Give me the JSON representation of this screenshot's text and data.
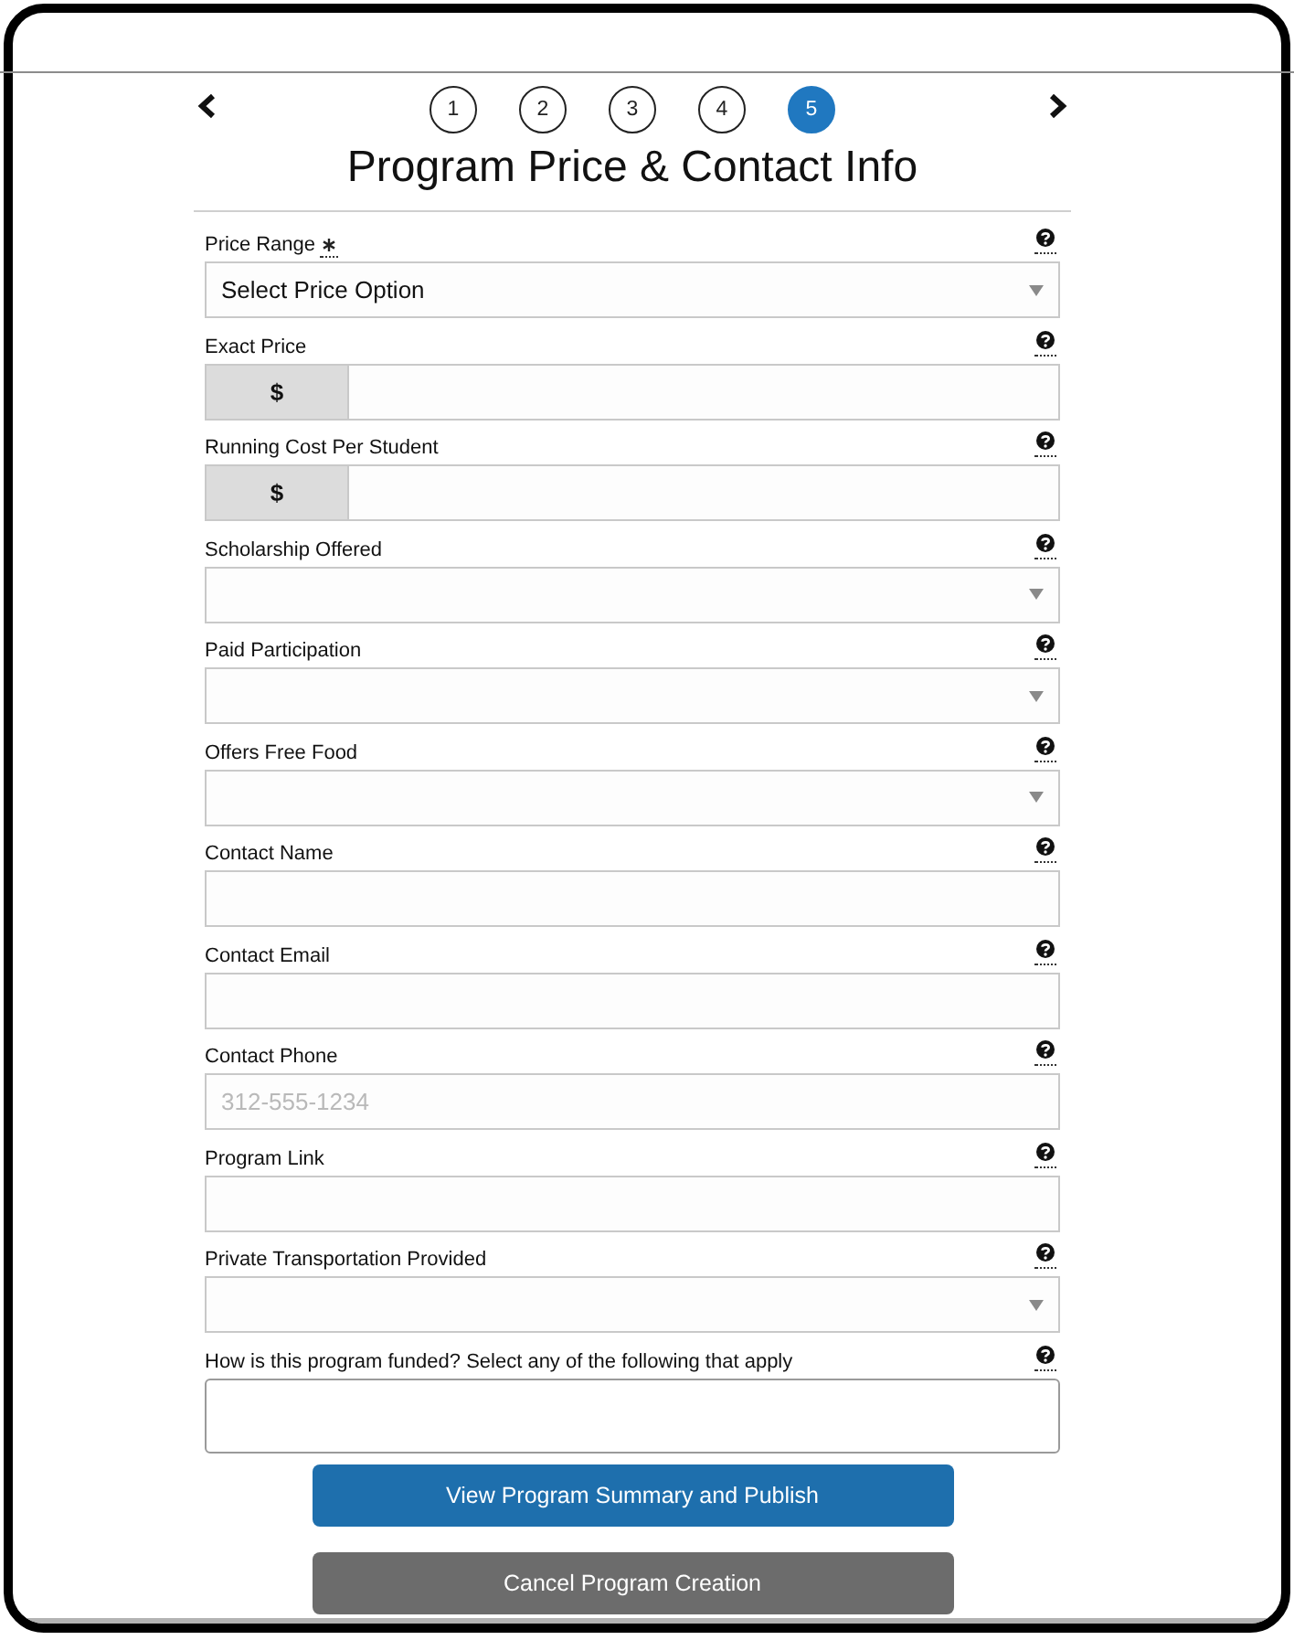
{
  "steps": [
    {
      "label": "1",
      "selected": false
    },
    {
      "label": "2",
      "selected": false
    },
    {
      "label": "3",
      "selected": false
    },
    {
      "label": "4",
      "selected": false
    },
    {
      "label": "5",
      "selected": true
    }
  ],
  "title": "Program Price & Contact Info",
  "fields": [
    {
      "kind": "select",
      "label": "Price Range",
      "required": true,
      "value": "Select Price Option"
    },
    {
      "kind": "currency",
      "label": "Exact Price",
      "required": false,
      "prefix": "$"
    },
    {
      "kind": "currency",
      "label": "Running Cost Per Student",
      "required": false,
      "prefix": "$"
    },
    {
      "kind": "select",
      "label": "Scholarship Offered",
      "required": false
    },
    {
      "kind": "select",
      "label": "Paid Participation",
      "required": false
    },
    {
      "kind": "select",
      "label": "Offers Free Food",
      "required": false
    },
    {
      "kind": "text",
      "label": "Contact Name",
      "required": false
    },
    {
      "kind": "text",
      "label": "Contact Email",
      "required": false
    },
    {
      "kind": "text",
      "label": "Contact Phone",
      "required": false,
      "placeholder": "312-555-1234"
    },
    {
      "kind": "text",
      "label": "Program Link",
      "required": false
    },
    {
      "kind": "select",
      "label": "Private Transportation Provided",
      "required": false
    },
    {
      "kind": "multiselect",
      "label": "How is this program funded? Select any of the following that apply",
      "required": false
    }
  ],
  "buttons": [
    {
      "kind": "primary",
      "label": "View Program Summary and Publish"
    },
    {
      "kind": "secondary",
      "label": "Cancel Program Creation"
    }
  ]
}
